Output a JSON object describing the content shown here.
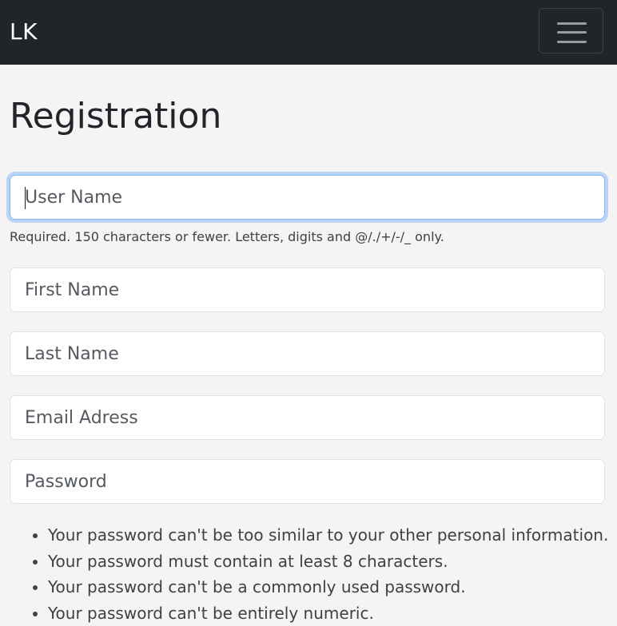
{
  "navbar": {
    "brand": "LK",
    "toggler_icon": "hamburger-menu-icon"
  },
  "page": {
    "title": "Registration"
  },
  "form": {
    "username": {
      "placeholder": "User Name",
      "value": "",
      "focused": true
    },
    "username_help": "Required. 150 characters or fewer. Letters, digits and @/./+/-/_ only.",
    "first_name": {
      "placeholder": "First Name",
      "value": ""
    },
    "last_name": {
      "placeholder": "Last Name",
      "value": ""
    },
    "email": {
      "placeholder": "Email Adress",
      "value": ""
    },
    "password": {
      "placeholder": "Password",
      "value": ""
    },
    "password_rules": [
      "Your password can't be too similar to your other personal information.",
      "Your password must contain at least 8 characters.",
      "Your password can't be a commonly used password.",
      "Your password can't be entirely numeric."
    ]
  },
  "colors": {
    "navbar_bg": "#212529",
    "page_bg": "#f4f4f4",
    "focus_ring": "#86b7fe"
  }
}
